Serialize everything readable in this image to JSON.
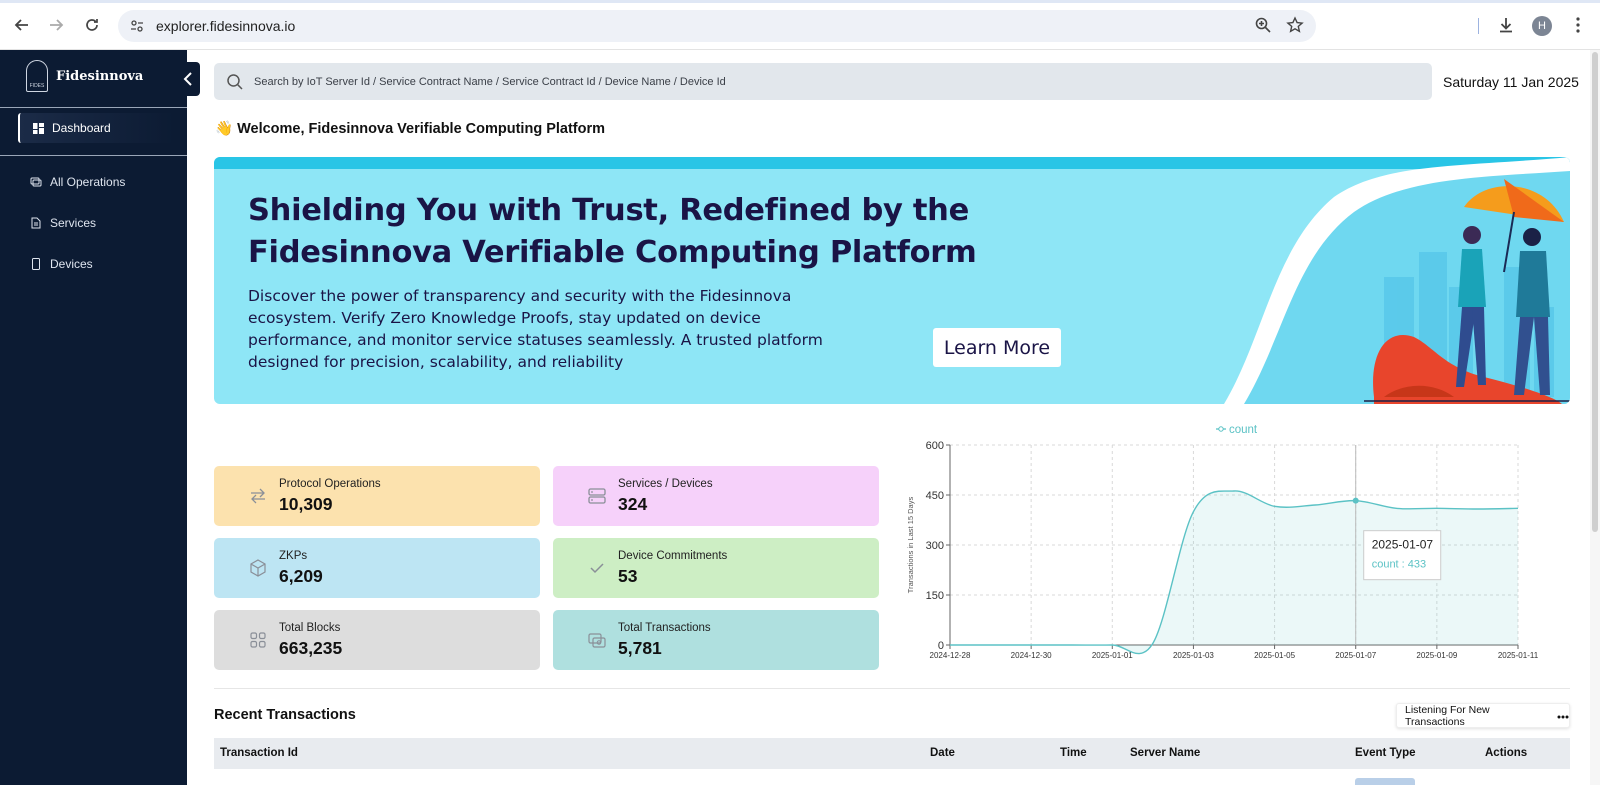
{
  "browser": {
    "url": "explorer.fidesinnova.io",
    "profile_initial": "H"
  },
  "sidebar": {
    "brand": "Fidesinnova",
    "logo_text": "FIDES",
    "items": [
      {
        "label": "Dashboard",
        "icon": "grid-icon",
        "active": true
      },
      {
        "label": "All Operations",
        "icon": "operations-icon",
        "active": false
      },
      {
        "label": "Services",
        "icon": "document-icon",
        "active": false
      },
      {
        "label": "Devices",
        "icon": "device-icon",
        "active": false
      }
    ]
  },
  "header": {
    "search_placeholder": "Search by IoT Server Id / Service Contract Name / Service Contract Id / Device Name / Device Id",
    "date": "Saturday 11 Jan 2025",
    "welcome": "👋 Welcome, Fidesinnova Verifiable Computing Platform"
  },
  "banner": {
    "title": "Shielding You with Trust, Redefined by the Fidesinnova Verifiable Computing Platform",
    "body": "Discover the power of transparency and security with the Fidesinnova ecosystem. Verify Zero Knowledge Proofs, stay updated on device performance, and monitor service statuses seamlessly. A trusted platform designed for precision, scalability, and reliability",
    "cta": "Learn More"
  },
  "stats": [
    {
      "label": "Protocol Operations",
      "value": "10,309",
      "icon": "swap-arrows-icon",
      "color": "#fce2ae"
    },
    {
      "label": "Services / Devices",
      "value": "324",
      "icon": "server-icon",
      "color": "#f6d1fa"
    },
    {
      "label": "ZKPs",
      "value": "6,209",
      "icon": "cube-icon",
      "color": "#bde5f3"
    },
    {
      "label": "Device Commitments",
      "value": "53",
      "icon": "check-icon",
      "color": "#cdeec4"
    },
    {
      "label": "Total Blocks",
      "value": "663,235",
      "icon": "blocks-icon",
      "color": "#dddddd"
    },
    {
      "label": "Total Transactions",
      "value": "5,781",
      "icon": "transactions-icon",
      "color": "#afe0df"
    }
  ],
  "chart_data": {
    "type": "area",
    "legend": "count",
    "ylabel": "Transactions in Last 15 Days",
    "ylim": [
      0,
      600
    ],
    "yticks": [
      0,
      150,
      300,
      450,
      600
    ],
    "xticks": [
      "2024-12-28",
      "2024-12-30",
      "2025-01-01",
      "2025-01-03",
      "2025-01-05",
      "2025-01-07",
      "2025-01-09",
      "2025-01-11"
    ],
    "series": [
      {
        "name": "count",
        "x": [
          "2024-12-28",
          "2024-12-29",
          "2024-12-30",
          "2024-12-31",
          "2025-01-01",
          "2025-01-02",
          "2025-01-03",
          "2025-01-04",
          "2025-01-05",
          "2025-01-06",
          "2025-01-07",
          "2025-01-08",
          "2025-01-09",
          "2025-01-10",
          "2025-01-11"
        ],
        "values": [
          0,
          0,
          0,
          0,
          0,
          5,
          400,
          462,
          416,
          420,
          433,
          410,
          410,
          408,
          410
        ]
      }
    ],
    "tooltip": {
      "date": "2025-01-07",
      "label": "count : 433"
    },
    "color": "#5bc2c5",
    "grid": true
  },
  "recent": {
    "title": "Recent Transactions",
    "listening": "Listening For New Transactions",
    "columns": [
      "Transaction Id",
      "Date",
      "Time",
      "Server Name",
      "Event Type",
      "Actions"
    ]
  }
}
